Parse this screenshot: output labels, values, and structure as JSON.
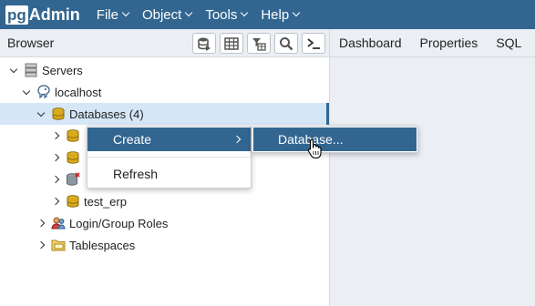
{
  "app": {
    "logo_pg": "pg",
    "logo_admin": "Admin"
  },
  "menubar": {
    "items": [
      {
        "label": "File"
      },
      {
        "label": "Object"
      },
      {
        "label": "Tools"
      },
      {
        "label": "Help"
      }
    ]
  },
  "browser": {
    "title": "Browser",
    "toolbar": [
      {
        "icon": "database-query-icon"
      },
      {
        "icon": "table-grid-icon"
      },
      {
        "icon": "filter-table-icon"
      },
      {
        "icon": "search-icon"
      },
      {
        "icon": "terminal-icon"
      }
    ]
  },
  "tabs": [
    {
      "label": "Dashboard"
    },
    {
      "label": "Properties"
    },
    {
      "label": "SQL"
    }
  ],
  "tree": {
    "servers": "Servers",
    "localhost": "localhost",
    "databases": "Databases (4)",
    "db4": "test_erp",
    "login_roles": "Login/Group Roles",
    "tablespaces": "Tablespaces"
  },
  "context_menu": {
    "create": "Create",
    "refresh": "Refresh"
  },
  "submenu": {
    "database": "Database..."
  },
  "colors": {
    "accent": "#326690",
    "selected_row": "#d5e6f6"
  }
}
